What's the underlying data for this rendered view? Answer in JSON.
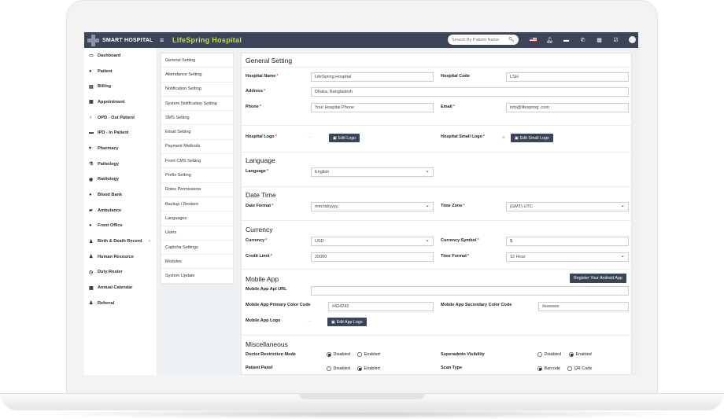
{
  "app": {
    "brand": "SMART HOSPITAL",
    "title": "LifeSpring Hospital",
    "search_placeholder": "Search By Patient Name"
  },
  "topbar_icons": [
    "search-icon",
    "flag-icon",
    "bell-icon",
    "bed-icon",
    "whatsapp-icon",
    "calendar-icon",
    "task-icon",
    "avatar"
  ],
  "sidebar": {
    "items": [
      {
        "label": "Dashboard",
        "icon": "monitor-icon"
      },
      {
        "label": "Patient",
        "icon": "user-icon"
      },
      {
        "label": "Billing",
        "icon": "file-icon"
      },
      {
        "label": "Appointment",
        "icon": "calendar-icon"
      },
      {
        "label": "OPD - Out Patient",
        "icon": "stethoscope-icon"
      },
      {
        "label": "IPD - In Patient",
        "icon": "bed-icon"
      },
      {
        "label": "Pharmacy",
        "icon": "mortar-icon"
      },
      {
        "label": "Pathology",
        "icon": "flask-icon"
      },
      {
        "label": "Radiology",
        "icon": "radiology-icon"
      },
      {
        "label": "Blood Bank",
        "icon": "drop-icon"
      },
      {
        "label": "Ambulance",
        "icon": "ambulance-icon"
      },
      {
        "label": "Front Office",
        "icon": "dot-icon"
      },
      {
        "label": "Birth & Death Record",
        "icon": "family-icon"
      },
      {
        "label": "Human Resource",
        "icon": "users-icon"
      },
      {
        "label": "Duty Roster",
        "icon": "clock-icon"
      },
      {
        "label": "Annual Calendar",
        "icon": "calendar-icon"
      },
      {
        "label": "Referral",
        "icon": "group-icon"
      }
    ]
  },
  "settings_menu": {
    "items": [
      "General Setting",
      "Attendance Setting",
      "Notification Setting",
      "System Notification Setting",
      "SMS Setting",
      "Email Setting",
      "Payment Methods",
      "Front CMS Setting",
      "Prefix Setting",
      "Roles Permissions",
      "Backup / Restore",
      "Languages",
      "Users",
      "Captcha Settings",
      "Modules",
      "System Update"
    ]
  },
  "general": {
    "title": "General Setting",
    "hospital_name_label": "Hospital Name",
    "hospital_name": "LifeSpring Hospital",
    "hospital_code_label": "Hospital Code",
    "hospital_code": "LSH",
    "address_label": "Address",
    "address": "Dhaka, Bangladesh",
    "phone_label": "Phone",
    "phone": "Your Hospital Phone",
    "email_label": "Email",
    "email": "info@lifespring .com",
    "logo_label": "Hospital Logo",
    "edit_logo": "Edit Logo",
    "small_logo_label": "Hospital Small Logo",
    "edit_small_logo": "Edit Small Logo"
  },
  "language": {
    "title": "Language",
    "label": "Language",
    "value": "English"
  },
  "datetime": {
    "title": "Date Time",
    "date_format_label": "Date Format",
    "date_format": "mm/dd/yyyy",
    "time_zone_label": "Time Zone",
    "time_zone": "(GMT) UTC"
  },
  "currency": {
    "title": "Currency",
    "currency_label": "Currency",
    "currency": "USD",
    "symbol_label": "Currency Symbol",
    "symbol": "$",
    "credit_label": "Credit Limit",
    "credit": "20000",
    "time_format_label": "Time Format",
    "time_format": "12 Hour"
  },
  "mobile": {
    "title": "Mobile App",
    "register_button": "Register Your Android App",
    "api_url_label": "Mobile App Api URL",
    "api_url": "",
    "primary_color_label": "Mobile App Primary Color Code",
    "primary_color": "#424242",
    "secondary_color_label": "Mobile App Secondary Color Code",
    "secondary_color": "#eeeeee",
    "logo_label": "Mobile App Logo",
    "edit_logo": "Edit App Logo"
  },
  "misc": {
    "title": "Miscellaneous",
    "doctor_restriction_label": "Doctor Restriction Mode",
    "superadmin_label": "Superadmin Visibility",
    "patient_panel_label": "Patient Panel",
    "scan_type_label": "Scan Type",
    "disabled": "Disabled",
    "enabled": "Enabled",
    "barcode": "Barcode",
    "qrcode": "QR Code",
    "doctor_restriction_selected": "Disabled",
    "superadmin_selected": "Enabled",
    "patient_panel_selected": "Enabled",
    "scan_type_selected": "Barcode"
  },
  "colors": {
    "topbar": "#3b4557",
    "accent_title": "#c6e23a",
    "required": "#dd3333"
  }
}
